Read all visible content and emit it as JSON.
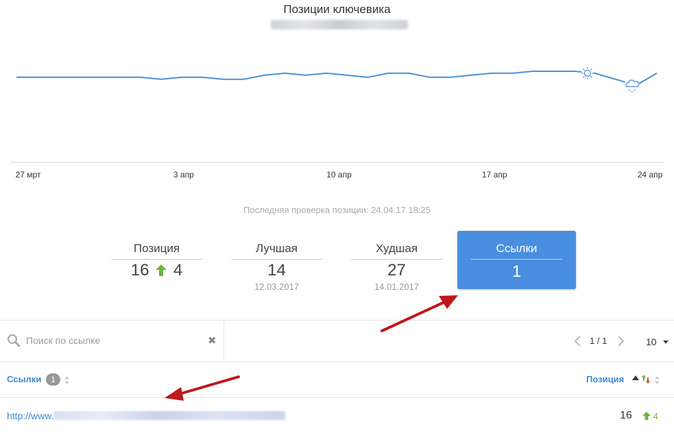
{
  "header": {
    "title": "Позиции ключевика",
    "subtitle": ""
  },
  "chart_data": {
    "type": "line",
    "title": "Позиции ключевика",
    "x_tick_labels": [
      "27 мрт",
      "3 апр",
      "10 апр",
      "17 апр",
      "24 апр"
    ],
    "x_ticks_day_index": [
      0,
      7,
      14,
      21,
      28
    ],
    "values": [
      16,
      16,
      16,
      16,
      16,
      16,
      16,
      16.5,
      16,
      16,
      16.5,
      16.5,
      15.5,
      15,
      15.5,
      15,
      15.5,
      16,
      15,
      15,
      16,
      16,
      15.5,
      15,
      15,
      14.5,
      14.5,
      14.5,
      15,
      16.5,
      18,
      15
    ],
    "ylim": [
      7,
      36
    ],
    "y_inverted": true,
    "grid": false,
    "line_color": "#4a8fd8",
    "annotations": [
      {
        "day_index": 25,
        "icon": "sun-icon"
      },
      {
        "day_index": 27,
        "icon": "cloud-rain-icon"
      }
    ]
  },
  "last_check": "Последняя проверка позиции: 24.04.17 18:25",
  "stats": {
    "position": {
      "label": "Позиция",
      "value": "16",
      "change": "4"
    },
    "best": {
      "label": "Лучшая",
      "value": "14",
      "date": "12.03.2017"
    },
    "worst": {
      "label": "Худшая",
      "value": "27",
      "date": "14.01.2017"
    },
    "links": {
      "label": "Ссылки",
      "value": "1"
    }
  },
  "toolbar": {
    "search_placeholder": "Поиск по ссылке",
    "search_value": "",
    "pagination": "1 / 1",
    "per_page": "10"
  },
  "table": {
    "col_links": "Ссылки",
    "col_links_count": "1",
    "col_position": "Позиция",
    "rows": [
      {
        "url_prefix": "http://www.",
        "position": "16",
        "change": "4"
      }
    ]
  },
  "colors": {
    "accent": "#4a8ee0",
    "link": "#3d86cf",
    "positive": "#6db33f",
    "annotation_arrow": "#c0171b"
  }
}
